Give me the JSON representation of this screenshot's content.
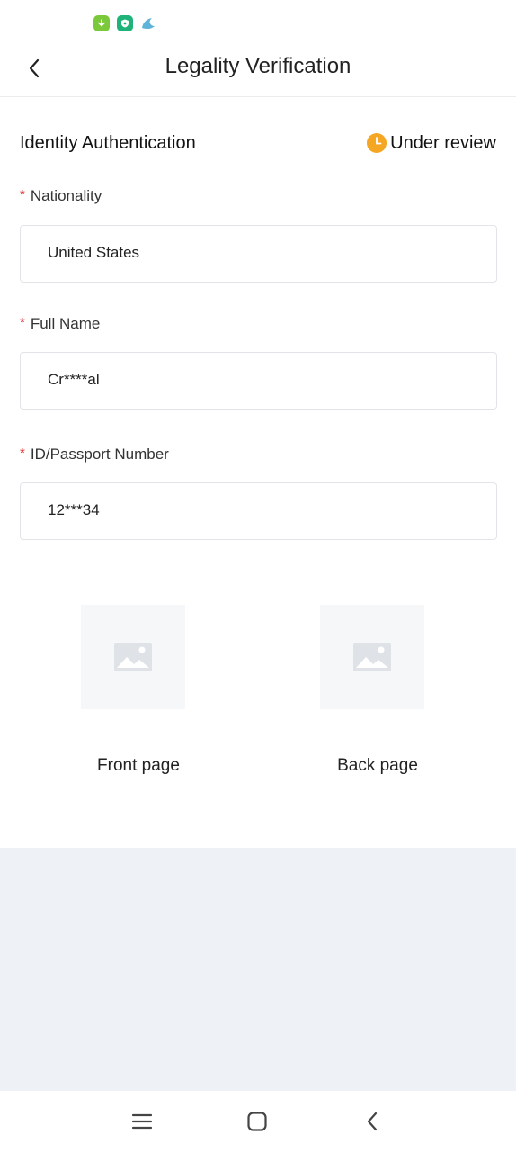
{
  "header": {
    "title": "Legality Verification"
  },
  "section": {
    "title": "Identity Authentication",
    "status": "Under review",
    "status_color": "#f5a623"
  },
  "fields": [
    {
      "label": "Nationality",
      "value": "United States"
    },
    {
      "label": "Full Name",
      "value": "Cr****al"
    },
    {
      "label": "ID/Passport Number",
      "value": "12***34"
    }
  ],
  "photos": {
    "front_label": "Front page",
    "back_label": "Back page"
  },
  "icons": {
    "status_bar": [
      "download-icon",
      "shield-icon",
      "bird-icon"
    ],
    "nav": [
      "menu-icon",
      "home-icon",
      "back-icon"
    ]
  },
  "colors": {
    "required": "#e03131",
    "footer_background": "#eef1f5"
  }
}
